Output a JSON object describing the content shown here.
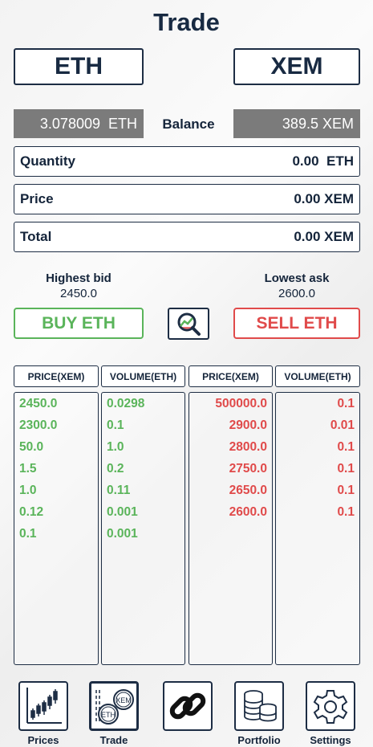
{
  "header": {
    "title": "Trade"
  },
  "pair": {
    "base": "ETH",
    "quote": "XEM"
  },
  "balance": {
    "base_amount": "3.078009",
    "base_unit": "ETH",
    "label": "Balance",
    "quote_amount": "389.5",
    "quote_unit": "XEM"
  },
  "form": {
    "quantity": {
      "label": "Quantity",
      "value": "0.00",
      "unit": "ETH"
    },
    "price": {
      "label": "Price",
      "value": "0.00",
      "unit": "XEM"
    },
    "total": {
      "label": "Total",
      "value": "0.00",
      "unit": "XEM"
    }
  },
  "market": {
    "highest_bid_label": "Highest bid",
    "highest_bid": "2450.0",
    "lowest_ask_label": "Lowest ask",
    "lowest_ask": "2600.0"
  },
  "actions": {
    "buy": "BUY ETH",
    "sell": "SELL ETH"
  },
  "orderbook": {
    "headers": [
      "PRICE(XEM)",
      "VOLUME(ETH)",
      "PRICE(XEM)",
      "VOLUME(ETH)"
    ],
    "bids": [
      {
        "price": "2450.0",
        "volume": "0.0298"
      },
      {
        "price": "2300.0",
        "volume": "0.1"
      },
      {
        "price": "50.0",
        "volume": "1.0"
      },
      {
        "price": "1.5",
        "volume": "0.2"
      },
      {
        "price": "1.0",
        "volume": "0.11"
      },
      {
        "price": "0.12",
        "volume": "0.001"
      },
      {
        "price": "0.1",
        "volume": "0.001"
      }
    ],
    "asks": [
      {
        "price": "500000.0",
        "volume": "0.1"
      },
      {
        "price": "2900.0",
        "volume": "0.01"
      },
      {
        "price": "2800.0",
        "volume": "0.1"
      },
      {
        "price": "2750.0",
        "volume": "0.1"
      },
      {
        "price": "2650.0",
        "volume": "0.1"
      },
      {
        "price": "2600.0",
        "volume": "0.1"
      }
    ]
  },
  "nav": [
    {
      "label": "Prices",
      "icon": "candlestick-chart-icon"
    },
    {
      "label": "Trade",
      "icon": "eth-xem-coins-icon",
      "active": true
    },
    {
      "label": "",
      "icon": "chain-link-icon"
    },
    {
      "label": "Portfolio",
      "icon": "coin-stack-icon"
    },
    {
      "label": "Settings",
      "icon": "gear-icon"
    }
  ],
  "colors": {
    "buy": "#5ab45a",
    "sell": "#e04a4a",
    "dark": "#1d2d44",
    "balance_bg": "#7b7b7b"
  }
}
